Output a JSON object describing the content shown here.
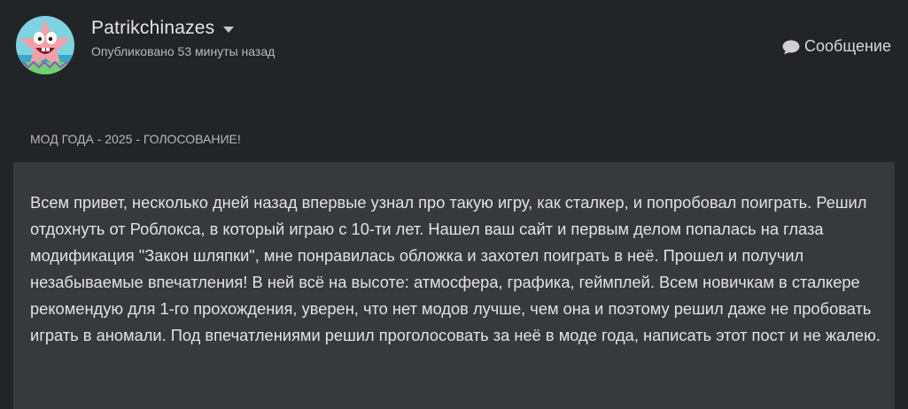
{
  "header": {
    "author_name": "Patrikchinazes",
    "published_label": "Опубликовано 53 минуты назад",
    "avatar_icon": "patrick-star-avatar",
    "dropdown_icon": "caret-down-icon",
    "message_button_label": "Сообщение",
    "message_icon": "speech-bubble-icon"
  },
  "post": {
    "title": "МОД ГОДА - 2025 - ГОЛОСОВАНИЕ!",
    "body": "Всем привет, несколько дней назад впервые узнал про такую игру, как сталкер, и попробовал поиграть. Решил отдохнуть от Роблокса, в который играю с 10-ти лет. Нашел ваш сайт и первым делом попалась на глаза модификация \"Закон шляпки\", мне понравилась обложка и захотел поиграть в неё. Прошел и получил незабываемые впечатления! В ней всё на высоте: атмосфера, графика, геймплей. Всем новичкам в сталкере рекомендую для 1-го прохождения, уверен, что нет модов лучше, чем она и поэтому решил даже не пробовать играть в аномали. Под впечатлениями решил проголосовать за неё в моде года, написать этот пост и не жалею."
  },
  "colors": {
    "page_background": "#232427",
    "content_background": "#38393d",
    "text_primary": "#e2e2e2",
    "text_secondary": "#b9b9b9"
  }
}
